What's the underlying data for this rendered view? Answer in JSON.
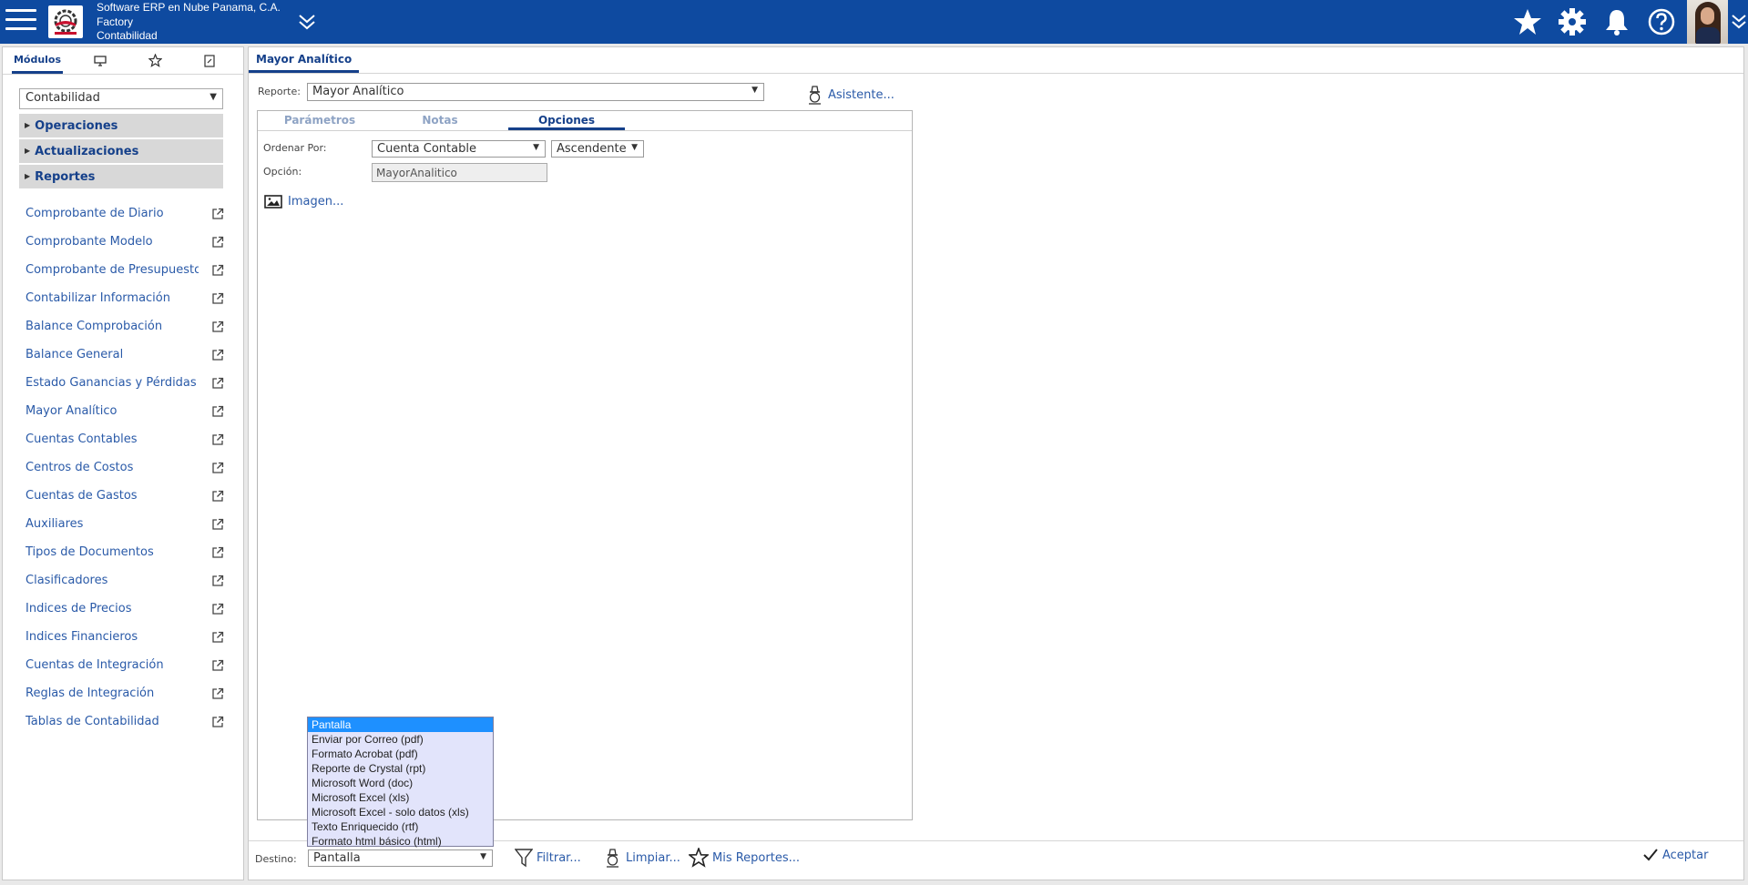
{
  "header": {
    "company": "Software ERP en Nube Panama, C.A.",
    "branch": "Factory",
    "module": "Contabilidad",
    "icons": [
      "menu-icon",
      "company-logo",
      "collapse-chevron-icon",
      "star-icon",
      "gear-icon",
      "bell-icon",
      "help-icon",
      "user-avatar",
      "chevron-down-icon"
    ]
  },
  "sidebar": {
    "tabs": [
      "Módulos"
    ],
    "module_selected": "Contabilidad",
    "sections": [
      "Operaciones",
      "Actualizaciones",
      "Reportes"
    ],
    "items": [
      "Comprobante de Diario",
      "Comprobante Modelo",
      "Comprobante de Presupuesto",
      "Contabilizar Información",
      "Balance Comprobación",
      "Balance General",
      "Estado Ganancias y Pérdidas",
      "Mayor Analítico",
      "Cuentas Contables",
      "Centros de Costos",
      "Cuentas de Gastos",
      "Auxiliares",
      "Tipos de Documentos",
      "Clasificadores",
      "Indices de Precios",
      "Indices Financieros",
      "Cuentas de Integración",
      "Reglas de Integración",
      "Tablas de Contabilidad"
    ]
  },
  "main": {
    "tab_title": "Mayor Analítico",
    "reporte_label": "Reporte:",
    "reporte_value": "Mayor Analítico",
    "asistente": "Asistente...",
    "subtabs": [
      "Parámetros",
      "Notas",
      "Opciones"
    ],
    "ordenar_label": "Ordenar Por:",
    "ordenar_value": "Cuenta Contable",
    "orden_value": "Ascendente",
    "opcion_label": "Opción:",
    "opcion_value": "MayorAnalitico",
    "imagen": "Imagen..."
  },
  "destino": {
    "label": "Destino:",
    "value": "Pantalla",
    "options": [
      "Pantalla",
      "Enviar por Correo (pdf)",
      "Formato Acrobat (pdf)",
      "Reporte de Crystal (rpt)",
      "Microsoft Word (doc)",
      "Microsoft Excel (xls)",
      "Microsoft Excel - solo datos (xls)",
      "Texto Enriquecido (rtf)",
      "Formato html básico (html)"
    ]
  },
  "footer": {
    "filtrar": "Filtrar...",
    "limpiar": "Limpiar...",
    "mis_reportes": "Mis Reportes...",
    "aceptar": "Aceptar"
  },
  "colors": {
    "header_bg": "#0e4aa0",
    "accent": "#15408a",
    "link": "#2a5aa8",
    "dropdown_bg": "#e2e4fb",
    "dropdown_selected": "#1e90ff"
  }
}
